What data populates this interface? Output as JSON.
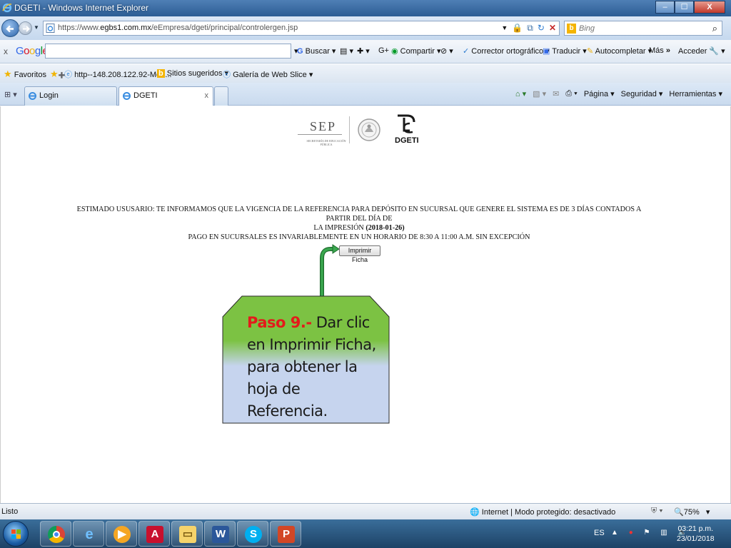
{
  "window": {
    "title": "DGETI - Windows Internet Explorer",
    "min_glyph": "‒",
    "max_glyph": "☐",
    "close_glyph": "X"
  },
  "address": {
    "url_prefix": "https://www.",
    "url_domain": "egbs1.com.mx",
    "url_path": "/eEmpresa/dgeti/principal/controlergen.jsp",
    "search_placeholder": "Bing"
  },
  "google_toolbar": {
    "close": "x",
    "logo": [
      "G",
      "o",
      "o",
      "g",
      "l",
      "e"
    ],
    "logo_colors": [
      "#3369e8",
      "#d50f25",
      "#eeb211",
      "#3369e8",
      "#009925",
      "#d50f25"
    ],
    "buscar": "Buscar",
    "compartir": "Compartir",
    "corrector": "Corrector ortográfico",
    "traducir": "Traducir",
    "autocompletar": "Autocompletar",
    "mas": "Más",
    "acceder": "Acceder"
  },
  "favorites_bar": {
    "favoritos": "Favoritos",
    "item1": "http--148.208.122.92-Men...",
    "item2": "Sitios sugeridos",
    "item3": "Galería de Web Slice"
  },
  "tabs": [
    {
      "label": "Login"
    },
    {
      "label": "DGETI",
      "close": "x"
    }
  ],
  "command_bar": {
    "pagina": "Página",
    "seguridad": "Seguridad",
    "herramientas": "Herramientas"
  },
  "page": {
    "logo_sep": "SEP",
    "logo_sep_sub": "SECRETARÍA DE EDUCACIÓN PÚBLICA",
    "logo_dgeti": "DGETI",
    "notice_line1": "ESTIMADO USUSARIO: TE INFORMAMOS QUE LA VIGENCIA DE LA REFERENCIA PARA DEPÓSITO EN SUCURSAL QUE GENERE EL SISTEMA ES DE 3 DÍAS CONTADOS A PARTIR DEL DÍA DE",
    "notice_line2": "LA IMPRESIÓN",
    "notice_date": "(2018-01-26)",
    "notice_line3": "PAGO EN SUCURSALES ES INVARIABLEMENTE EN UN HORARIO DE 8:30 A 11:00 A.M. SIN EXCEPCIÓN",
    "print_button": "Imprimir Ficha"
  },
  "callout": {
    "step": "Paso 9.-",
    "text": " Dar clic en Imprimir Ficha, para obtener la hoja de Referencia.",
    "gradient_top": "#7cc243",
    "gradient_bottom": "#c6d4ee",
    "step_color": "#e31b1b"
  },
  "status_bar": {
    "status": "Listo",
    "zone": "Internet | Modo protegido: desactivado",
    "zoom": "75%"
  },
  "taskbar": {
    "apps": [
      "chrome-icon",
      "internet-explorer-icon",
      "media-player-icon",
      "acrobat-icon",
      "file-explorer-icon",
      "word-icon",
      "skype-icon",
      "powerpoint-icon"
    ],
    "lang": "ES",
    "time": "03:21 p.m.",
    "date": "23/01/2018"
  }
}
